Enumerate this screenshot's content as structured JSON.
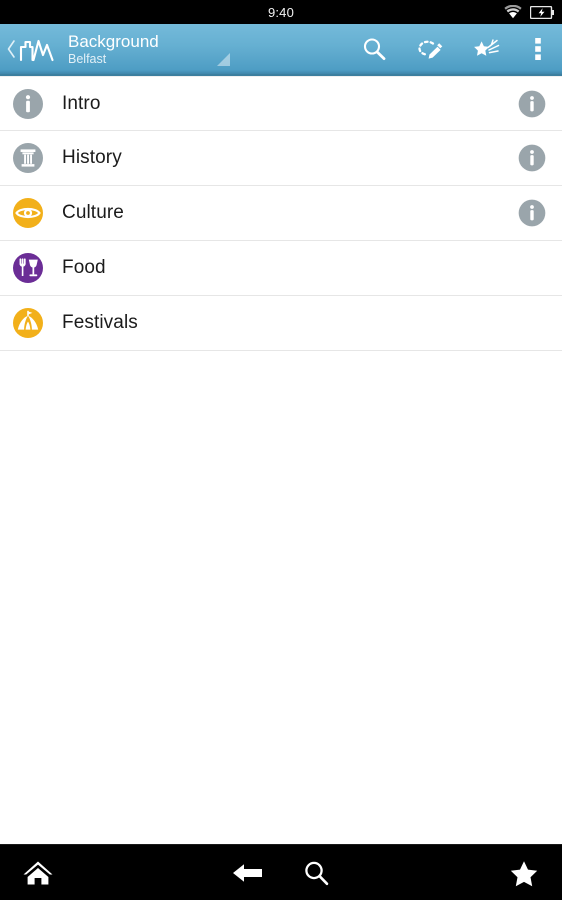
{
  "status_bar": {
    "time": "9:40",
    "wifi_icon": "wifi-icon",
    "battery_icon": "battery-charging-icon"
  },
  "app_bar": {
    "back_icon": "back-chevron-icon",
    "logo_icon": "skyline-logo-icon",
    "title": "Background",
    "subtitle": "Belfast",
    "spinner_icon": "dropdown-caret-icon",
    "accent_color": "#66b0d2",
    "actions": [
      {
        "name": "search-icon",
        "label": "Search"
      },
      {
        "name": "edit-route-icon",
        "label": "Edit"
      },
      {
        "name": "star-sparkle-icon",
        "label": "Highlights"
      },
      {
        "name": "overflow-menu-icon",
        "label": "More options"
      }
    ]
  },
  "list": {
    "items": [
      {
        "label": "Intro",
        "icon": "info-circle-icon",
        "icon_color": "#9aa5ab",
        "has_info": true
      },
      {
        "label": "History",
        "icon": "pillar-icon",
        "icon_color": "#9aa5ab",
        "has_info": true
      },
      {
        "label": "Culture",
        "icon": "eye-icon",
        "icon_color": "#f2b01a",
        "has_info": true
      },
      {
        "label": "Food",
        "icon": "fork-wineglass-icon",
        "icon_color": "#6b2d96",
        "has_info": false
      },
      {
        "label": "Festivals",
        "icon": "festival-tent-icon",
        "icon_color": "#f2b01a",
        "has_info": false
      }
    ],
    "info_badge_color": "#9aa5ab"
  },
  "bottom_nav": {
    "background_color": "#000000",
    "buttons": [
      {
        "name": "home-icon",
        "label": "Home"
      },
      {
        "name": "back-arrow-icon",
        "label": "Back"
      },
      {
        "name": "search-icon",
        "label": "Search"
      },
      {
        "name": "star-icon",
        "label": "Favorites"
      }
    ]
  }
}
